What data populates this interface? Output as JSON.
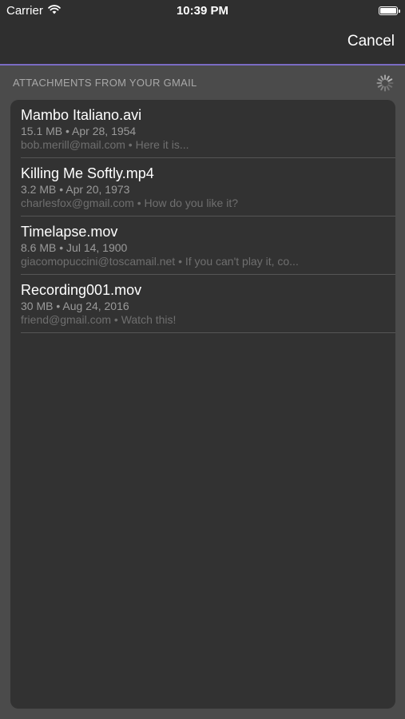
{
  "status_bar": {
    "carrier": "Carrier",
    "time": "10:39 PM",
    "icons": [
      "wifi-icon",
      "battery-icon"
    ]
  },
  "nav": {
    "cancel_label": "Cancel"
  },
  "section": {
    "title": "ATTACHMENTS FROM YOUR GMAIL",
    "loading_icon": "activity-spinner-icon"
  },
  "attachments": [
    {
      "filename": "Mambo Italiano.avi",
      "meta": "15.1 MB • Apr 28, 1954",
      "sub": "bob.merill@mail.com • Here it is..."
    },
    {
      "filename": "Killing Me Softly.mp4",
      "meta": "3.2 MB • Apr 20, 1973",
      "sub": "charlesfox@gmail.com • How do you like it?"
    },
    {
      "filename": "Timelapse.mov",
      "meta": "8.6 MB • Jul 14, 1900",
      "sub": "giacomopuccini@toscamail.net • If you can't play it, co..."
    },
    {
      "filename": "Recording001.mov",
      "meta": "30 MB • Aug 24, 2016",
      "sub": "friend@gmail.com • Watch this!"
    }
  ],
  "colors": {
    "accent_line": "#7b6cc4",
    "background": "#4b4b4b",
    "card": "#323232"
  }
}
